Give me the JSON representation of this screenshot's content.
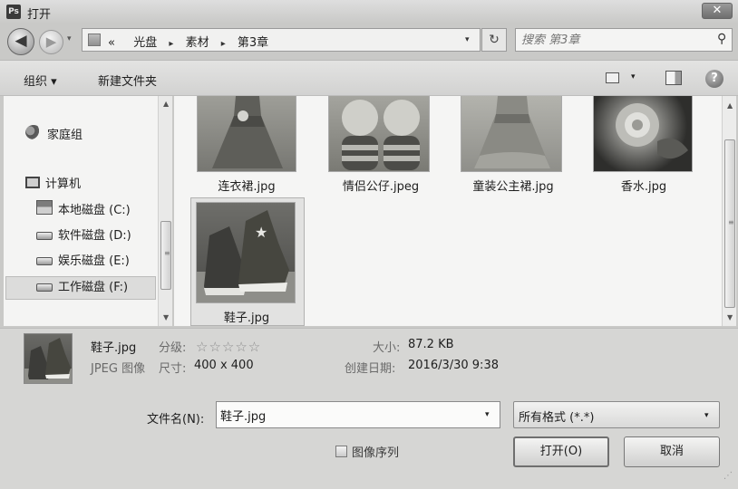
{
  "window": {
    "title": "打开",
    "app_icon_text": "Ps",
    "close_label": "✕"
  },
  "nav_buttons": {
    "back_icon": "◀",
    "forward_icon": "▶",
    "history_icon": "▾"
  },
  "address": {
    "overflow_marker": "«",
    "crumbs": [
      "光盘",
      "素材",
      "第3章"
    ],
    "separator": "▸",
    "dropdown_icon": "▾",
    "refresh_icon": "↻"
  },
  "search": {
    "placeholder": "搜索 第3章",
    "icon": "⚲"
  },
  "toolbar": {
    "organize_label": "组织 ▾",
    "new_folder_label": "新建文件夹",
    "view_drop_icon": "▾",
    "help_label": "?"
  },
  "nav": {
    "homegroup": "家庭组",
    "computer": "计算机",
    "drives": [
      {
        "label": "本地磁盘 (C:)"
      },
      {
        "label": "软件磁盘 (D:)"
      },
      {
        "label": "娱乐磁盘 (E:)"
      },
      {
        "label": "工作磁盘 (F:)"
      }
    ],
    "selected_index": 3
  },
  "files": [
    {
      "name": "连衣裙.jpg",
      "thumb": "dress-image"
    },
    {
      "name": "情侣公仔.jpeg",
      "thumb": "plush-toys-image"
    },
    {
      "name": "童装公主裙.jpg",
      "thumb": "lace-dress-image"
    },
    {
      "name": "香水.jpg",
      "thumb": "perfume-flower-image"
    },
    {
      "name": "鞋子.jpg",
      "thumb": "sneakers-image",
      "selected": true
    }
  ],
  "scroll_icons": {
    "up": "▲",
    "down": "▼",
    "grip": "≡"
  },
  "details": {
    "name": "鞋子.jpg",
    "rating_label": "分级:",
    "stars": "☆☆☆☆☆",
    "type": "JPEG 图像",
    "dimensions_label": "尺寸:",
    "dimensions": "400 x 400",
    "size_label": "大小:",
    "size": "87.2 KB",
    "created_label": "创建日期:",
    "created": "2016/3/30 9:38"
  },
  "bottom": {
    "filename_label": "文件名(N):",
    "filename_value": "鞋子.jpg",
    "filename_drop_icon": "▾",
    "format_value": "所有格式 (*.*)",
    "format_drop_icon": "▾",
    "sequence_label": "图像序列",
    "open_label": "打开(O)",
    "cancel_label": "取消",
    "grip": "⋰"
  }
}
